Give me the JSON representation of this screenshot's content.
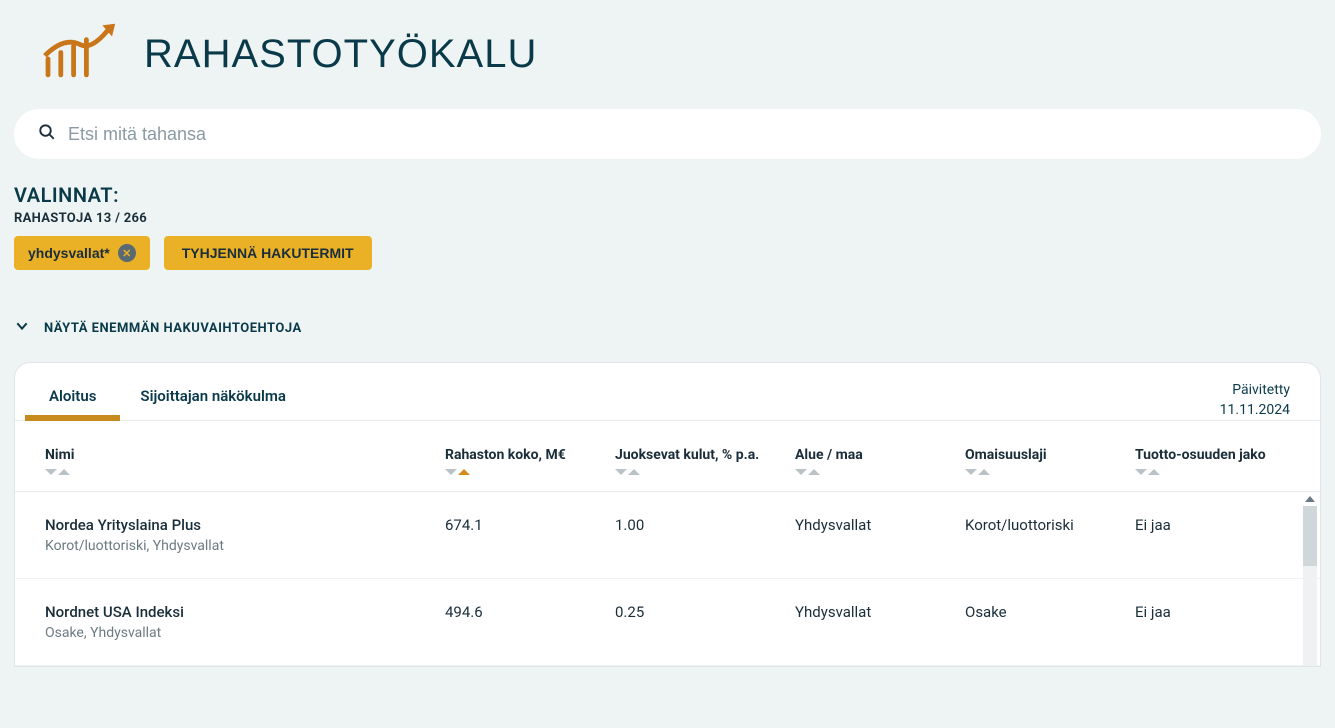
{
  "header": {
    "title": "RAHASTOTYÖKALU"
  },
  "search": {
    "placeholder": "Etsi mitä tahansa",
    "value": ""
  },
  "filters": {
    "title": "VALINNAT:",
    "count_label": "RAHASTOJA 13 / 266",
    "chip_text": "yhdysvallat*",
    "clear_label": "TYHJENNÄ HAKUTERMIT"
  },
  "expand": {
    "label": "NÄYTÄ ENEMMÄN HAKUVAIHTOEHTOJA"
  },
  "tabs": {
    "items": [
      {
        "label": "Aloitus",
        "active": true
      },
      {
        "label": "Sijoittajan näkökulma",
        "active": false
      }
    ]
  },
  "updated": {
    "label": "Päivitetty",
    "date": "11.11.2024"
  },
  "columns": [
    {
      "label": "Nimi",
      "sort_active": ""
    },
    {
      "label": "Rahaston koko, M€",
      "sort_active": "up"
    },
    {
      "label": "Juoksevat kulut, % p.a.",
      "sort_active": ""
    },
    {
      "label": "Alue / maa",
      "sort_active": ""
    },
    {
      "label": "Omaisuuslaji",
      "sort_active": ""
    },
    {
      "label": "Tuotto-osuuden jako",
      "sort_active": ""
    }
  ],
  "rows": [
    {
      "name": "Nordea Yrityslaina Plus",
      "sub": "Korot/luottoriski, Yhdysvallat",
      "size": "674.1",
      "cost": "1.00",
      "region": "Yhdysvallat",
      "asset": "Korot/luottoriski",
      "dist": "Ei jaa"
    },
    {
      "name": "Nordnet USA Indeksi",
      "sub": "Osake, Yhdysvallat",
      "size": "494.6",
      "cost": "0.25",
      "region": "Yhdysvallat",
      "asset": "Osake",
      "dist": "Ei jaa"
    }
  ]
}
